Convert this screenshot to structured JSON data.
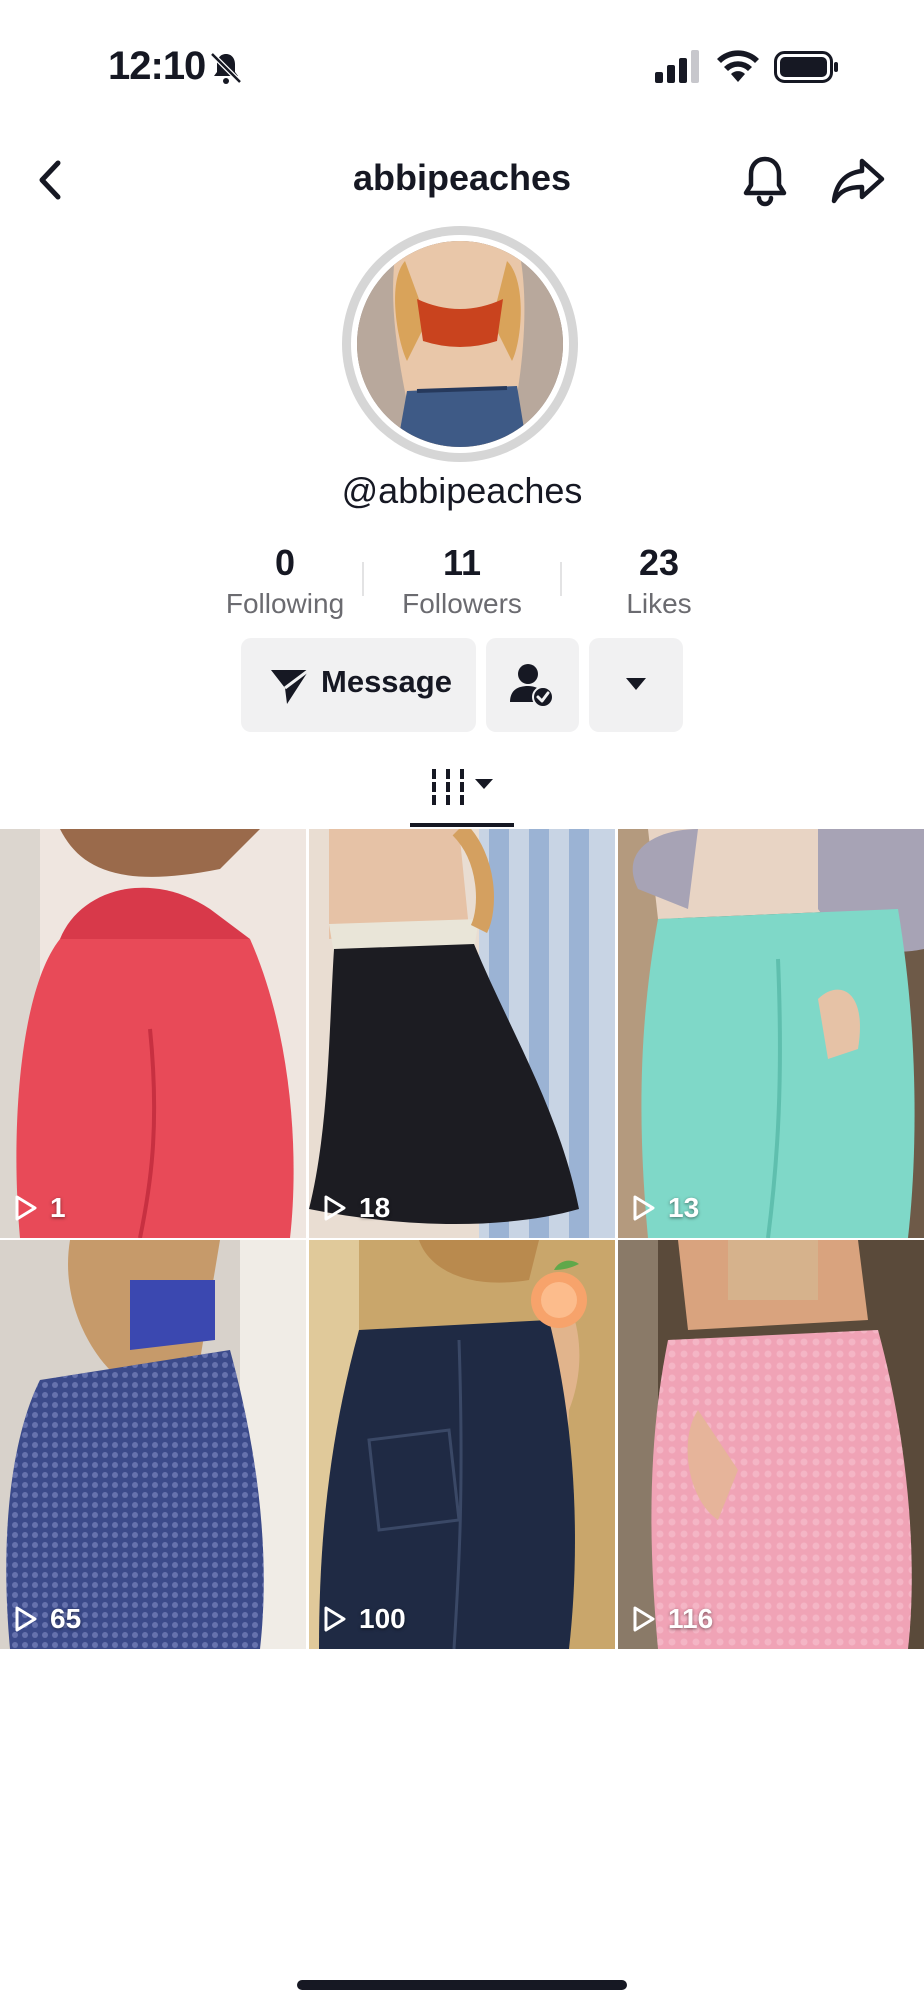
{
  "status_bar": {
    "time": "12:10",
    "icons": [
      "bell-slash-icon",
      "cellular-signal-icon",
      "wifi-icon",
      "battery-icon"
    ]
  },
  "nav": {
    "title": "abbipeaches",
    "back_icon": "chevron-left-icon",
    "bell_icon": "bell-icon",
    "share_icon": "share-arrow-icon"
  },
  "profile": {
    "handle": "@abbipeaches",
    "stats": [
      {
        "value": "0",
        "label": "Following"
      },
      {
        "value": "11",
        "label": "Followers"
      },
      {
        "value": "23",
        "label": "Likes"
      }
    ],
    "actions": {
      "message_label": "Message",
      "message_icon": "send-icon",
      "friend_icon": "user-check-icon",
      "more_icon": "caret-down-icon"
    }
  },
  "tabs": {
    "active_icon": "video-grid-icon",
    "dropdown_icon": "caret-down-icon"
  },
  "videos": [
    {
      "views": "1",
      "colors": [
        "#e84a58",
        "#f4a0a8"
      ]
    },
    {
      "views": "18",
      "colors": [
        "#1c1c22",
        "#9bb3d4"
      ]
    },
    {
      "views": "13",
      "colors": [
        "#7fd8c8",
        "#a7a3b5"
      ]
    },
    {
      "views": "65",
      "colors": [
        "#3b4a8a",
        "#c9bfb5"
      ]
    },
    {
      "views": "100",
      "colors": [
        "#1f2a44",
        "#c9a66b"
      ]
    },
    {
      "views": "116",
      "colors": [
        "#f0a3b6",
        "#5a4a3a"
      ]
    }
  ]
}
